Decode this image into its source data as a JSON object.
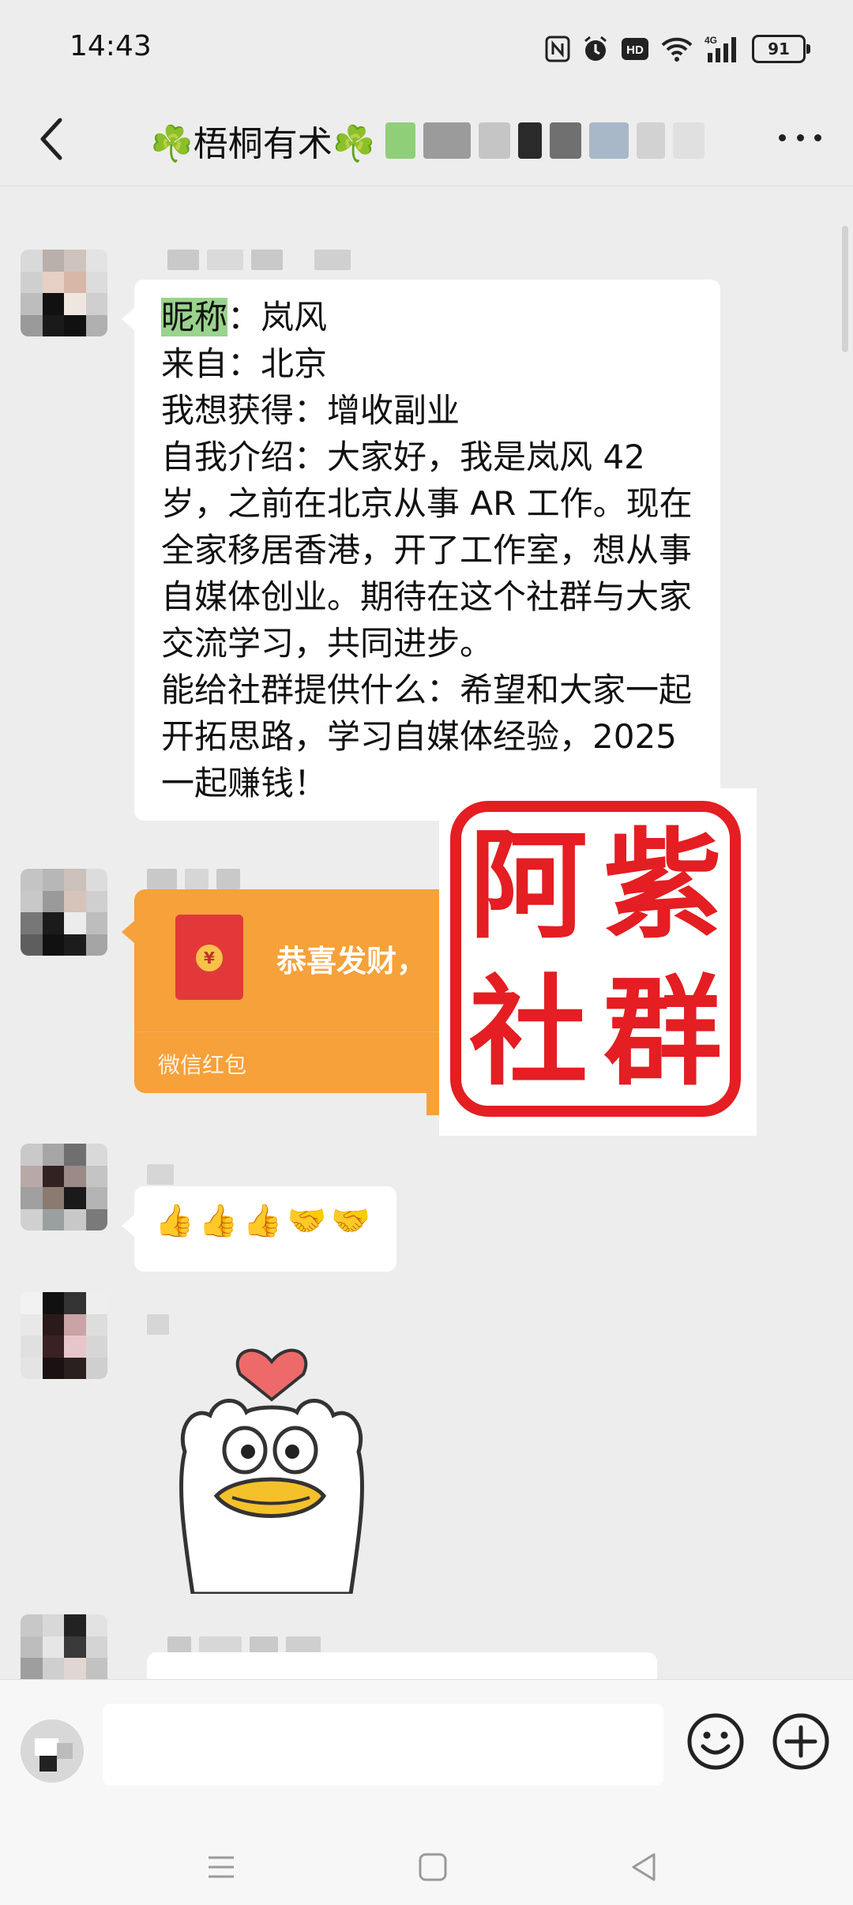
{
  "status_bar": {
    "time": "14:43",
    "battery": "91",
    "icons": [
      "nfc-icon",
      "alarm-icon",
      "hd-icon",
      "wifi-icon",
      "4g-signal-icon",
      "battery-icon"
    ]
  },
  "header": {
    "title": "☘️梧桐有术☘️",
    "back_icon": "chevron-left-icon",
    "more_icon": "more-horizontal-icon"
  },
  "messages": [
    {
      "type": "text",
      "lines": [
        {
          "highlight": "昵称",
          "text": "：岚风"
        },
        {
          "text": "来自：北京"
        },
        {
          "text": "我想获得：增收副业"
        },
        {
          "text": "自我介绍：大家好，我是岚风 42 岁，之前在北京从事 AR 工作。现在全家移居香港，开了工作室，想从事自媒体创业。期待在这个社群与大家交流学习，共同进步。"
        },
        {
          "text": "能给社群提供什么：希望和大家一起开拓思路，学习自媒体经验，2025 一起赚钱！"
        }
      ]
    },
    {
      "type": "red_packet",
      "greeting": "恭喜发财，",
      "coin": "¥",
      "label": "微信红包"
    },
    {
      "type": "emoji",
      "emojis": [
        "👍",
        "👍",
        "👍",
        "🤝",
        "🤝"
      ]
    },
    {
      "type": "sticker",
      "sticker": "duck-heart-sticker"
    }
  ],
  "watermark": {
    "chars": [
      "阿",
      "紫",
      "社",
      "群"
    ]
  },
  "input_bar": {
    "placeholder": "",
    "emoji_icon": "smiley-icon",
    "plus_icon": "plus-circle-icon"
  },
  "system_nav": {
    "icons": [
      "menu-icon",
      "home-square-icon",
      "back-triangle-icon"
    ]
  },
  "colors": {
    "background": "#ededed",
    "bubble": "#ffffff",
    "highlight": "#9ad38c",
    "red_packet": "#f6a13a",
    "stamp_red": "#e41e22"
  }
}
